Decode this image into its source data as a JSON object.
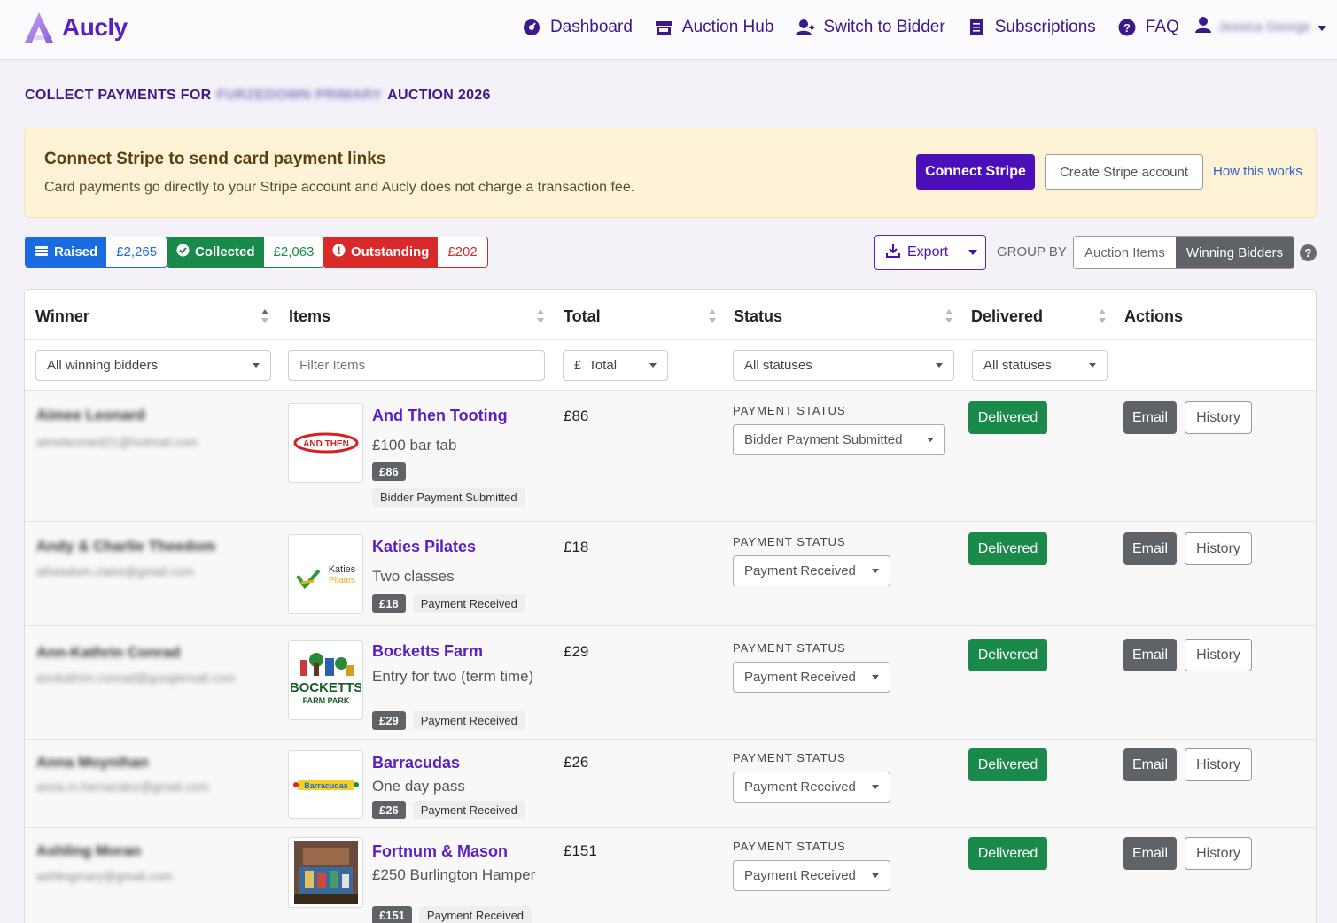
{
  "app": {
    "name": "Aucly"
  },
  "nav": {
    "links": [
      {
        "label": "Dashboard",
        "icon": "dashboard-icon"
      },
      {
        "label": "Auction Hub",
        "icon": "store-icon"
      },
      {
        "label": "Switch to Bidder",
        "icon": "user-icon"
      },
      {
        "label": "Subscriptions",
        "icon": "receipt-icon"
      },
      {
        "label": "FAQ",
        "icon": "question-icon"
      }
    ],
    "user_name": "Jessica George"
  },
  "page": {
    "title_prefix": "COLLECT PAYMENTS FOR",
    "title_school": "FURZEDOWN PRIMARY",
    "title_suffix": "AUCTION 2026"
  },
  "banner": {
    "title": "Connect Stripe to send card payment links",
    "text": "Card payments go directly to your Stripe account and Aucly does not charge a transaction fee.",
    "connect_label": "Connect Stripe",
    "create_label": "Create Stripe account",
    "link_label": "How this works"
  },
  "stats": {
    "raised_label": "Raised",
    "raised_value": "£2,265",
    "collected_label": "Collected",
    "collected_value": "£2,063",
    "outstanding_label": "Outstanding",
    "outstanding_value": "£202"
  },
  "toolbar": {
    "export_label": "Export",
    "group_by_label": "GROUP BY",
    "group_options": [
      "Auction Items",
      "Winning Bidders"
    ],
    "group_active": "Winning Bidders"
  },
  "table": {
    "headers": {
      "winner": "Winner",
      "items": "Items",
      "total": "Total",
      "status": "Status",
      "delivered": "Delivered",
      "actions": "Actions"
    },
    "filters": {
      "winner": "All winning bidders",
      "items_placeholder": "Filter Items",
      "total_prefix": "£",
      "total": "Total",
      "status": "All statuses",
      "delivered": "All statuses"
    },
    "payment_status_label": "PAYMENT STATUS",
    "delivered_label": "Delivered",
    "email_label": "Email",
    "history_label": "History",
    "rows": [
      {
        "winner": "Aimee Leonard",
        "email": "aimeleonard21@hotmail.com",
        "item_title": "And Then Tooting",
        "item_desc": "£100 bar tab",
        "price_badge": "£86",
        "status_badge": "Bidder Payment Submitted",
        "total": "£86",
        "payment_status": "Bidder Payment Submitted",
        "logo_text": "AND THEN"
      },
      {
        "winner": "Andy & Charlie Theedom",
        "email": "atheedom.claire@gmail.com",
        "item_title": "Katies Pilates",
        "item_desc": "Two classes",
        "price_badge": "£18",
        "status_badge": "Payment Received",
        "total": "£18",
        "payment_status": "Payment Received",
        "logo_text": "Katies",
        "logo_text2": "Pilates"
      },
      {
        "winner": "Ann-Kathrin Conrad",
        "email": "annkathrin.conrad@googlemail.com",
        "item_title": "Bocketts Farm",
        "item_desc": "Entry for two (term time)",
        "price_badge": "£29",
        "status_badge": "Payment Received",
        "total": "£29",
        "payment_status": "Payment Received",
        "logo_text": "BOCKETTS",
        "logo_text2": "FARM PARK"
      },
      {
        "winner": "Anna Moynihan",
        "email": "anna.m.hernandez@gmail.com",
        "item_title": "Barracudas",
        "item_desc": "One day pass",
        "price_badge": "£26",
        "status_badge": "Payment Received",
        "total": "£26",
        "payment_status": "Payment Received",
        "logo_text": "Barracudas"
      },
      {
        "winner": "Ashling Moran",
        "email": "ashlingmary@gmail.com",
        "item_title": "Fortnum & Mason",
        "item_desc": "£250 Burlington Hamper",
        "price_badge": "£151",
        "status_badge": "Payment Received",
        "total": "£151",
        "payment_status": "Payment Received"
      }
    ]
  },
  "colors": {
    "brand": "#5a1fc4",
    "primary_button": "#4a0fb8",
    "success": "#1a8a4a",
    "danger": "#d92a2a",
    "info": "#1a6ae0"
  }
}
